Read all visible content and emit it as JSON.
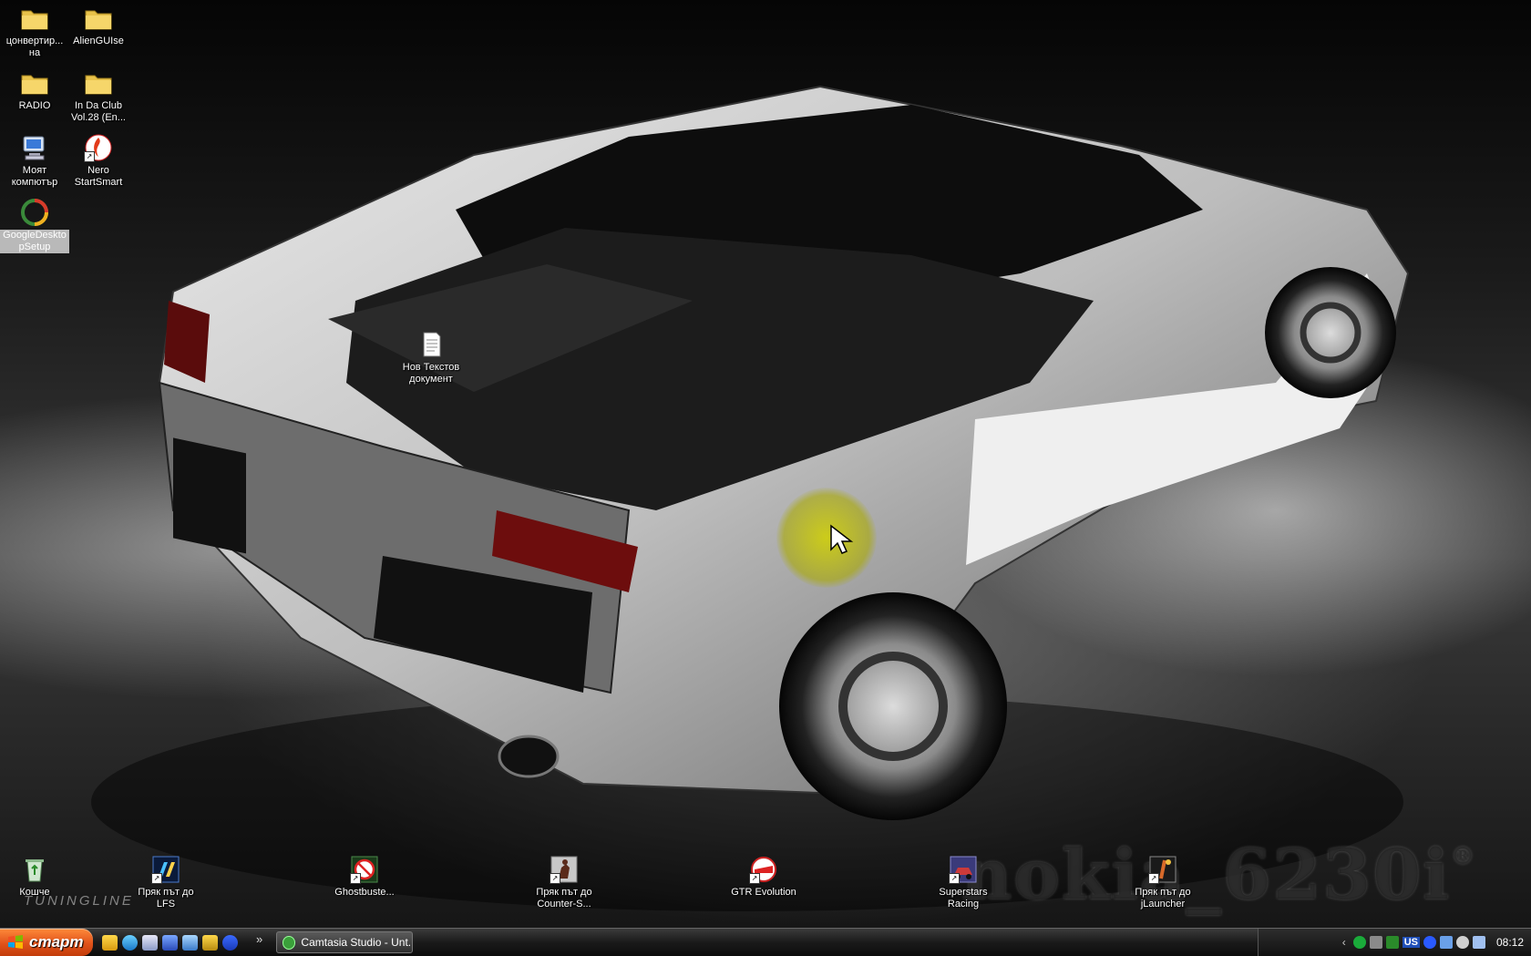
{
  "desktop": {
    "icons": [
      {
        "id": "converter",
        "label": "цонвертир...\nна",
        "type": "folder"
      },
      {
        "id": "alienguise",
        "label": "AlienGUIse",
        "type": "folder"
      },
      {
        "id": "radio",
        "label": "RADIO",
        "type": "folder"
      },
      {
        "id": "indaclub",
        "label": "In Da Club\nVol.28 (En...",
        "type": "folder"
      },
      {
        "id": "mycomputer",
        "label": "Моят\nкомпютър",
        "type": "computer"
      },
      {
        "id": "nero",
        "label": "Nero\nStartSmart",
        "type": "app"
      },
      {
        "id": "googledesktop",
        "label": "GoogleDeskto\npSetup",
        "type": "app",
        "selected": true
      },
      {
        "id": "newtext",
        "label": "Нов Текстов\nдокумент",
        "type": "textfile"
      },
      {
        "id": "recycle",
        "label": "Кошче",
        "type": "recycle"
      },
      {
        "id": "lfs",
        "label": "Пряк път до\nLFS",
        "type": "shortcut"
      },
      {
        "id": "ghostbusters",
        "label": "Ghostbuste...",
        "type": "shortcut"
      },
      {
        "id": "counterstrike",
        "label": "Пряк път до\nCounter-S...",
        "type": "shortcut"
      },
      {
        "id": "gtr",
        "label": "GTR Evolution",
        "type": "shortcut"
      },
      {
        "id": "superstars",
        "label": "Superstars\nRacing",
        "type": "shortcut"
      },
      {
        "id": "jlauncher",
        "label": "Пряк път до\njLauncher",
        "type": "shortcut"
      }
    ],
    "watermark": "nokia_6230i",
    "watermark_mark": "®",
    "brand_logo": "TUNINGLINE"
  },
  "taskbar": {
    "start_label": "старт",
    "quicklaunch_more": "»",
    "tasks": [
      {
        "label": "Camtasia Studio - Unt..."
      }
    ],
    "tray": {
      "language": "US",
      "clock": "08:12"
    }
  },
  "colors": {
    "start_button": "#e0521a",
    "taskbar": "#1a1a1a",
    "cursor_highlight": "#c8c800"
  }
}
